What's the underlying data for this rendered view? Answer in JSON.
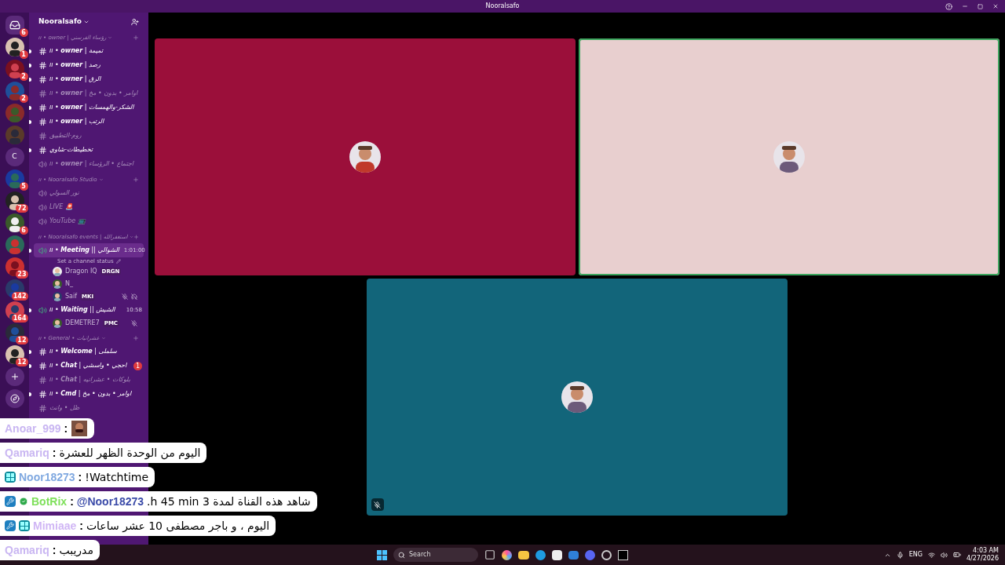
{
  "window": {
    "title": "Nooralsafo"
  },
  "servers": [
    {
      "kind": "home",
      "badge": "6"
    },
    {
      "kind": "avatar",
      "badge": "1"
    },
    {
      "kind": "avatar",
      "badge": "2"
    },
    {
      "kind": "avatar",
      "badge": "2"
    },
    {
      "kind": "avatar"
    },
    {
      "kind": "avatar"
    },
    {
      "kind": "letter",
      "letter": "C"
    },
    {
      "kind": "avatar",
      "badge": "5"
    },
    {
      "kind": "avatar",
      "badge": "72"
    },
    {
      "kind": "avatar",
      "badge": "6"
    },
    {
      "kind": "avatar"
    },
    {
      "kind": "avatar",
      "badge": "23"
    },
    {
      "kind": "avatar",
      "badge": "142"
    },
    {
      "kind": "avatar",
      "badge": "164"
    },
    {
      "kind": "avatar",
      "badge": "12"
    },
    {
      "kind": "avatar",
      "badge": "12"
    },
    {
      "kind": "add"
    },
    {
      "kind": "discover"
    }
  ],
  "server_name": "Nooralsafo",
  "categories": [
    {
      "name": "ıı • owner | رؤساء الفرسني",
      "channels": [
        {
          "kind": "text",
          "unread": true,
          "name": "ıı • **owner** | تميمة"
        },
        {
          "kind": "text",
          "unread": true,
          "name": "ıı • **owner** | رصد"
        },
        {
          "kind": "text",
          "unread": true,
          "name": "ıı • **owner** | الرق"
        },
        {
          "kind": "text",
          "unread": false,
          "name": "ıı • **owner** | اوامر • بدون • مخ"
        },
        {
          "kind": "text",
          "unread": true,
          "name": "ıı • **owner** | الشكر-والهمسات"
        },
        {
          "kind": "text",
          "unread": true,
          "name": "ıı • **owner** | الرتب"
        },
        {
          "kind": "text",
          "unread": false,
          "name": "روم-التطبيق"
        },
        {
          "kind": "text",
          "unread": true,
          "name": "تخطيطات-شاوي"
        },
        {
          "kind": "voice",
          "unread": false,
          "name": "ıı • **owner** | اجتماع • الرؤساء"
        }
      ]
    },
    {
      "name": "ıı • Nooralsafo Studio",
      "channels": [
        {
          "kind": "voice",
          "unread": false,
          "name": "نور السولي"
        },
        {
          "kind": "voice",
          "unread": false,
          "name": "LIVE 🚨"
        },
        {
          "kind": "voice",
          "unread": false,
          "name": "YouTube 📺"
        }
      ]
    },
    {
      "name": "ıı • Nooralsafo events | استغفرالله",
      "channels": [
        {
          "kind": "voice",
          "unread": true,
          "selected": true,
          "name": "ıı • **Meeting** || الشوالي",
          "time": "1:01:00",
          "status": "Set a channel status",
          "members": [
            {
              "name": "Dragon IQ",
              "tag": "DRGN",
              "muted": false,
              "deafened": false
            },
            {
              "name": "N_",
              "muted": false,
              "deafened": false
            },
            {
              "name": "Saif",
              "tag": "MKI",
              "muted": true,
              "deafened": true
            }
          ]
        },
        {
          "kind": "voice",
          "unread": true,
          "selected": false,
          "name": "ıı • **Waiting** || الشيش",
          "time": "10:58",
          "members": [
            {
              "name": "DEMETRE7",
              "tag": "PMC",
              "muted": true,
              "deafened": false
            }
          ]
        }
      ]
    },
    {
      "name": "ıı • General • عشرانيات",
      "channels": [
        {
          "kind": "text",
          "unread": true,
          "name": "ıı • **Welcome** | سلملى"
        },
        {
          "kind": "text",
          "unread": true,
          "name": "ıı • **Chat** | احجي • واسشي",
          "badge": "1"
        },
        {
          "kind": "text",
          "unread": false,
          "name": "ıı • **Chat** | بلوكات • عشرانيه"
        },
        {
          "kind": "text",
          "unread": true,
          "name": "ıı • **Cmd** | اوامر • بدون • مخ"
        },
        {
          "kind": "text",
          "unread": false,
          "name": "ظل • وانث"
        }
      ]
    }
  ],
  "tiles": [
    {
      "color": "#9b0f3a",
      "speaking": false,
      "muted": false
    },
    {
      "color": "#e8cfcf",
      "speaking": true,
      "muted": false
    },
    {
      "color": "#12657a",
      "speaking": false,
      "muted": true
    }
  ],
  "chat": [
    {
      "kind": "emote",
      "user": "Anoar_999",
      "color": "#c9b6f2",
      "moderator": false,
      "subscriber": false,
      "verified": false,
      "separator": ":"
    },
    {
      "kind": "text",
      "user": "Qamariq",
      "color": "#c9b6f2",
      "moderator": false,
      "subscriber": false,
      "verified": false,
      "separator": ":",
      "message": "اليوم من الوحدة الظهر للعشرة"
    },
    {
      "kind": "text",
      "user": "Noor18273",
      "color": "#7fa8e0",
      "moderator": false,
      "subscriber": true,
      "verified": false,
      "separator": ":",
      "message": "!Watchtime"
    },
    {
      "kind": "text",
      "user": "BotRix",
      "color": "#7ee05a",
      "moderator": true,
      "subscriber": false,
      "verified": true,
      "separator": ":",
      "mention": "@Noor18273",
      "message": "شاهد هذه القناة لمدة 3 h 45 min."
    },
    {
      "kind": "text",
      "user": "Mimiaae",
      "color": "#d0b6f5",
      "moderator": true,
      "subscriber": true,
      "verified": false,
      "separator": ":",
      "message": "اليوم ، و باجر مصطفى 10 عشر ساعات"
    },
    {
      "kind": "text",
      "user": "Qamariq",
      "color": "#c9b6f2",
      "moderator": false,
      "subscriber": false,
      "verified": false,
      "separator": ":",
      "message": "مدريبب"
    }
  ],
  "taskbar": {
    "search_placeholder": "Search",
    "language": "ENG",
    "time": "4:03 AM",
    "date": "4/27/2026"
  }
}
